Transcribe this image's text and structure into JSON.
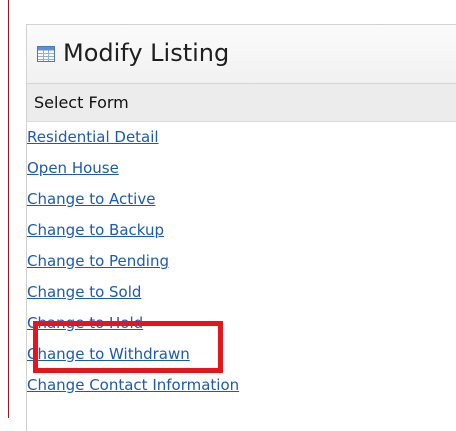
{
  "header": {
    "title": "Modify Listing",
    "icon": "table-icon"
  },
  "subheader": {
    "label": "Select Form"
  },
  "form_links": [
    {
      "label": "Residential Detail"
    },
    {
      "label": "Open House"
    },
    {
      "label": "Change to Active"
    },
    {
      "label": "Change to Backup"
    },
    {
      "label": "Change to Pending"
    },
    {
      "label": "Change to Sold"
    },
    {
      "label": "Change to Hold"
    },
    {
      "label": "Change to Withdrawn"
    },
    {
      "label": "Change Contact Information"
    }
  ],
  "colors": {
    "link": "#1b5ab8",
    "highlight": "#e8141b",
    "left_rule": "#b01010"
  },
  "highlighted_link": "Change to Hold"
}
